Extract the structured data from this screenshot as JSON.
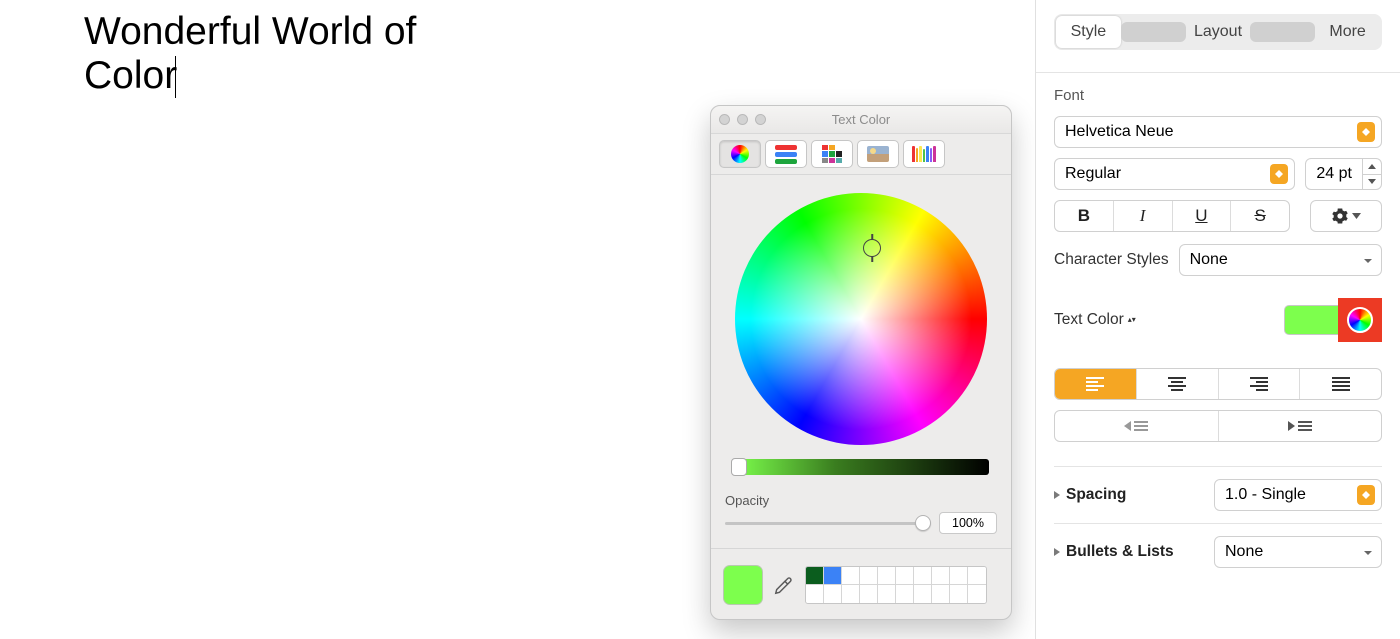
{
  "document": {
    "text": "Wonderful World of Color"
  },
  "color_picker": {
    "title": "Text Color",
    "opacity_label": "Opacity",
    "opacity_value": "100%",
    "current_color": "#7dff4d",
    "recent_colors": [
      "#0b5d1e",
      "#3b82f6"
    ]
  },
  "inspector": {
    "tabs": {
      "style": "Style",
      "layout": "Layout",
      "more": "More"
    },
    "font_section_label": "Font",
    "font_family": "Helvetica Neue",
    "font_style": "Regular",
    "font_size": "24 pt",
    "char_styles_label": "Character Styles",
    "char_styles_value": "None",
    "text_color_label": "Text Color",
    "text_color_swatch": "#7dff4d",
    "spacing_label": "Spacing",
    "spacing_value": "1.0 - Single",
    "bullets_label": "Bullets & Lists",
    "bullets_value": "None"
  }
}
